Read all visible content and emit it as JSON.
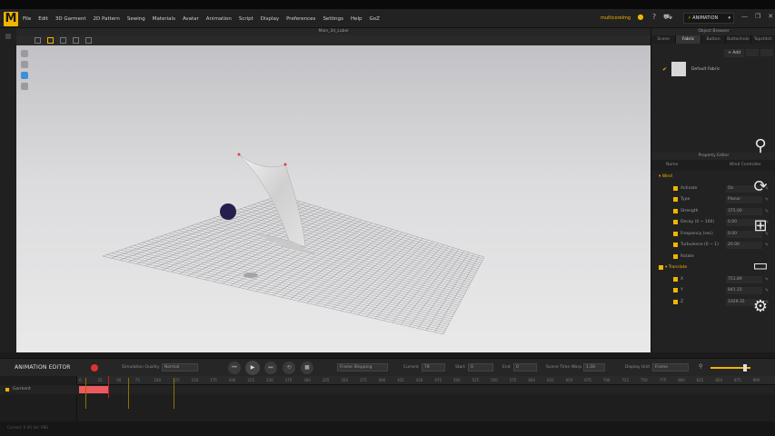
{
  "menubar": {
    "logo": "M",
    "items": [
      "File",
      "Edit",
      "3D Garment",
      "2D Pattern",
      "Sewing",
      "Materials",
      "Avatar",
      "Animation",
      "Script",
      "Display",
      "Preferences",
      "Settings",
      "Help",
      "GoZ"
    ],
    "workspace_label": "multicorelmg",
    "mode_label": "ANIMATION"
  },
  "viewport": {
    "tab_title": "Main_3d_Label"
  },
  "object_browser": {
    "title": "Object Browser",
    "tabs": [
      "Scene",
      "Fabric",
      "Button",
      "Buttonhole",
      "Topstitch"
    ],
    "active_tab": "Fabric",
    "add_label": "+ Add",
    "fabric_name": "Default Fabric"
  },
  "property_editor": {
    "title": "Property Editor",
    "col_name": "Name",
    "col_value": "Wind Controller",
    "sections": [
      {
        "name": "Wind",
        "rows": [
          {
            "label": "Activate",
            "value": "On"
          },
          {
            "label": "Type",
            "value": "Planar"
          },
          {
            "label": "Strength",
            "value": "375.00"
          },
          {
            "label": "Decay (0 ~ 100)",
            "value": "0.00"
          },
          {
            "label": "Frequency (sec)",
            "value": "0.00"
          },
          {
            "label": "Turbulence (0 ~ 1)",
            "value": "20.00"
          },
          {
            "label": "Rotate",
            "value": ""
          }
        ]
      },
      {
        "name": "Translate",
        "rows": [
          {
            "label": "X",
            "value": "751.89"
          },
          {
            "label": "Y",
            "value": "841.15"
          },
          {
            "label": "Z",
            "value": "1029.35"
          }
        ]
      }
    ]
  },
  "animation_editor": {
    "title": "ANIMATION EDITOR",
    "sim_quality_label": "Simulation Quality",
    "sim_quality_value": "Normal",
    "frame_mode": "Frame Stepping",
    "current_label": "Current",
    "current_value": "78",
    "start_label": "Start",
    "start_value": "0",
    "end_label": "End",
    "end_value": "0",
    "scene_time_label": "Scene Time Warp",
    "scene_time_value": "1.00",
    "display_unit_label": "Display Unit",
    "display_unit_value": "Frame",
    "track_name": "Garment",
    "ruler_ticks": [
      "0",
      "25",
      "50",
      "75",
      "100",
      "125",
      "150",
      "175",
      "200",
      "225",
      "250",
      "275",
      "300",
      "325",
      "350",
      "375",
      "400",
      "425",
      "450",
      "475",
      "500",
      "525",
      "550",
      "575",
      "600",
      "625",
      "650",
      "675",
      "700",
      "725",
      "750",
      "775",
      "800",
      "825",
      "850",
      "875",
      "900"
    ]
  },
  "status": {
    "text": "Current: 0 (0)   Sel: PBG"
  }
}
